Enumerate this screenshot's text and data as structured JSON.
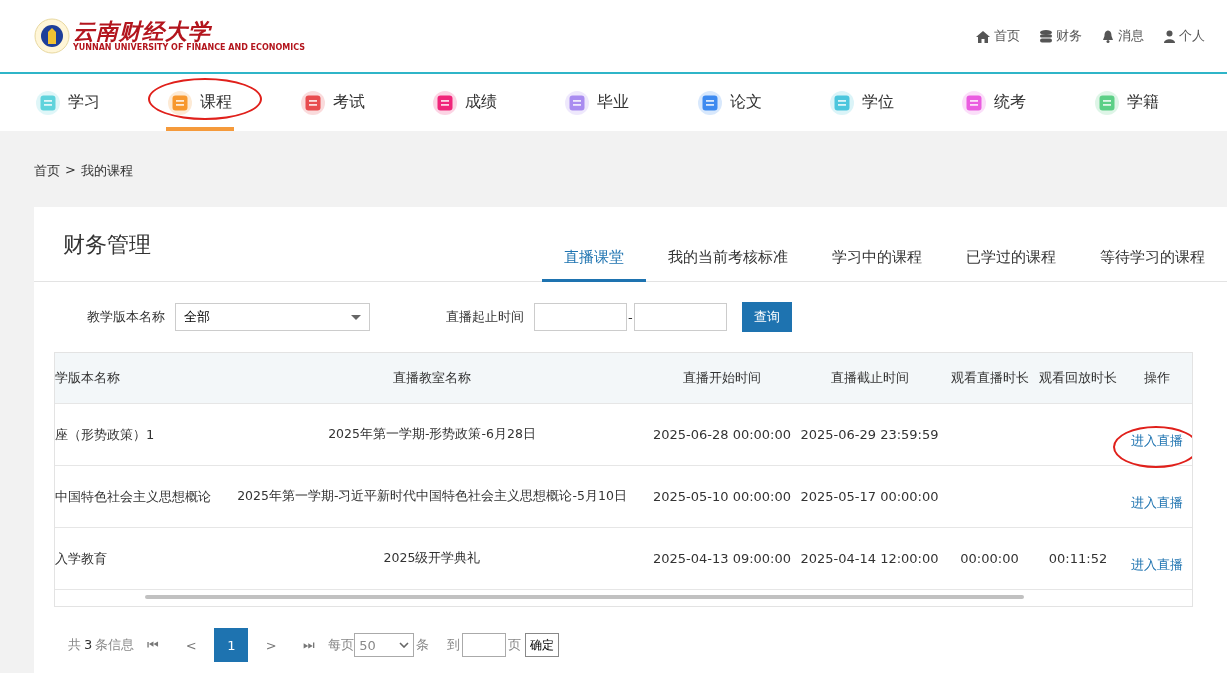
{
  "header": {
    "logo": {
      "name": "云南财经大学",
      "subtitle": "YUNNAN UNIVERSITY OF FINANCE AND ECONOMICS"
    },
    "links": [
      {
        "label": "首页"
      },
      {
        "label": "财务"
      },
      {
        "label": "消息"
      },
      {
        "label": "个人"
      }
    ]
  },
  "nav": [
    {
      "label": "学习",
      "color": "#5fd3dc",
      "selected": false,
      "circled": false
    },
    {
      "label": "课程",
      "color": "#f7982f",
      "selected": true,
      "circled": true
    },
    {
      "label": "考试",
      "color": "#e84c4f",
      "selected": false,
      "circled": false
    },
    {
      "label": "成绩",
      "color": "#f0267a",
      "selected": false,
      "circled": false
    },
    {
      "label": "毕业",
      "color": "#a98cf0",
      "selected": false,
      "circled": false
    },
    {
      "label": "论文",
      "color": "#3d8af0",
      "selected": false,
      "circled": false
    },
    {
      "label": "学位",
      "color": "#4cc6dd",
      "selected": false,
      "circled": false
    },
    {
      "label": "统考",
      "color": "#ea5ce0",
      "selected": false,
      "circled": false
    },
    {
      "label": "学籍",
      "color": "#5ccf86",
      "selected": false,
      "circled": false
    }
  ],
  "breadcrumb": [
    "首页",
    ">",
    "我的课程"
  ],
  "card": {
    "title": "财务管理",
    "tabs": [
      {
        "label": "直播课堂",
        "selected": true
      },
      {
        "label": "我的当前考核标准",
        "selected": false
      },
      {
        "label": "学习中的课程",
        "selected": false
      },
      {
        "label": "已学过的课程",
        "selected": false
      },
      {
        "label": "等待学习的课程",
        "selected": false
      }
    ],
    "filters": {
      "version_label": "教学版本名称",
      "version_value": "全部",
      "time_label": "直播起止时间",
      "separator": "-",
      "query_button": "查询"
    },
    "table": {
      "columns": [
        "学版本名称",
        "直播教室名称",
        "直播开始时间",
        "直播截止时间",
        "观看直播时长",
        "观看回放时长",
        "操作"
      ],
      "rows": [
        {
          "cells": [
            "座（形势政策）1",
            "2025年第一学期-形势政策-6月28日",
            "2025-06-28 00:00:00",
            "2025-06-29 23:59:59",
            "",
            ""
          ],
          "action": "进入直播",
          "action_circled": true
        },
        {
          "cells": [
            "中国特色社会主义思想概论",
            "2025年第一学期-习近平新时代中国特色社会主义思想概论-5月10日",
            "2025-05-10 00:00:00",
            "2025-05-17 00:00:00",
            "",
            ""
          ],
          "action": "进入直播",
          "action_circled": false
        },
        {
          "cells": [
            "入学教育",
            "2025级开学典礼",
            "2025-04-13 09:00:00",
            "2025-04-14 12:00:00",
            "00:00:00",
            "00:11:52"
          ],
          "action": "进入直播",
          "action_circled": false
        }
      ]
    },
    "pagination": {
      "total": [
        "共",
        "3",
        "条信息"
      ],
      "first": "⏮",
      "prev": "<",
      "pages": [
        {
          "label": "1",
          "selected": true
        }
      ],
      "next": ">",
      "last": "⏭",
      "per_page_label": "每页",
      "per_page": "50",
      "per_page_unit": "条",
      "goto_label": "到",
      "goto_unit": "页",
      "confirm": "确定"
    }
  }
}
